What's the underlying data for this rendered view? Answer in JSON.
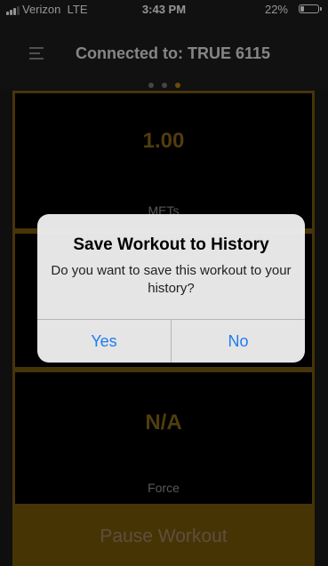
{
  "status_bar": {
    "carrier": "Verizon",
    "network": "LTE",
    "time": "3:43 PM",
    "battery_percent": "22%",
    "battery_level": 0.22
  },
  "header": {
    "title": "Connected to: TRUE 6115",
    "page_dots": {
      "count": 3,
      "active_index": 2
    }
  },
  "panels": [
    {
      "value": "1.00",
      "label": "METs"
    },
    {
      "value": "",
      "label": ""
    },
    {
      "value": "N/A",
      "label": "Force"
    }
  ],
  "pause_button": {
    "label": "Pause Workout"
  },
  "dialog": {
    "title": "Save Workout to History",
    "message": "Do you want to save this workout to your history?",
    "yes_label": "Yes",
    "no_label": "No"
  },
  "colors": {
    "accent": "#7b5a09",
    "value_text": "#8a6a18",
    "dialog_button": "#1e7cf2"
  }
}
